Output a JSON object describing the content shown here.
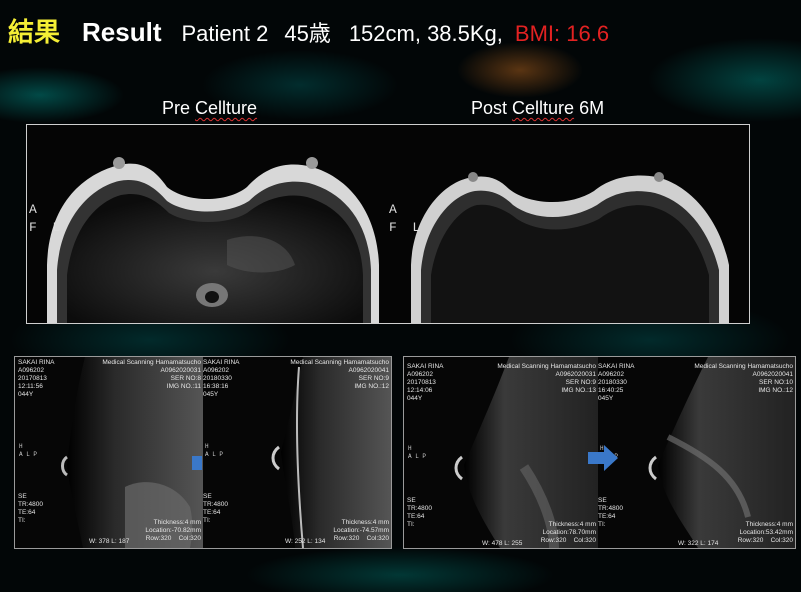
{
  "title": {
    "kanji": "結果",
    "result": "Result",
    "patient": "Patient 2",
    "age": "45歳",
    "measure": "152cm, 38.5Kg,",
    "bmi": "BMI: 16.6"
  },
  "captions": {
    "pre_prefix": "Pre ",
    "pre_word": "Cellture",
    "post_prefix": "Post ",
    "post_word": "Cellture",
    "post_suffix": " 6M"
  },
  "colors": {
    "bmi": "#e32222",
    "kanji": "#f5ef35",
    "arrow": "#3a78c9"
  },
  "orientation": {
    "a": "A",
    "f": "F",
    "l": "L"
  },
  "panels": [
    {
      "left": {
        "name": "SAKAI RINA\nA096202\n20170813\n12:11:56\n044Y",
        "site": "Medical Scanning Hamamatsucho\nA0962020031\nSER NO:8\nIMG NO.:11",
        "orient": "H\nA L P",
        "params": "SE\nTR:4800\nTE:64\nTI:",
        "thick": "Thickness:4 mm\nLocation:-70.82mm\nRow:320    Col:320",
        "wl": "W: 378 L: 187"
      },
      "right": {
        "name": "SAKAI RINA\nA096202\n20180330\n16:38:16\n045Y",
        "site": "Medical Scanning Hamamatsucho\nA0962020041\nSER NO:9\nIMG NO.:12",
        "orient": "H\nA L P",
        "params": "SE\nTR:4800\nTE:64\nTI:",
        "thick": "Thickness:4 mm\nLocation:-74.57mm\nRow:320    Col:320",
        "wl": "W: 252 L: 134"
      }
    },
    {
      "left": {
        "name": "SAKAI RINA\nA096202\n20170813\n12:14:06\n044Y",
        "site": "Medical Scanning Hamamatsucho\nA0962020031\nSER NO:9\nIMG NO.:13",
        "orient": "H\nA L P",
        "params": "SE\nTR:4800\nTE:64\nTI:",
        "thick": "Thickness:4 mm\nLocation:78.70mm\nRow:320    Col:320",
        "wl": "W: 478 L: 255"
      },
      "right": {
        "name": "SAKAI RINA\nA096202\n20180330\n16:40:25\n045Y",
        "site": "Medical Scanning Hamamatsucho\nA0962020041\nSER NO:10\nIMG NO.:12",
        "orient": "H\nA L P",
        "params": "SE\nTR:4800\nTE:64\nTI:",
        "thick": "Thickness:4 mm\nLocation:53.42mm\nRow:320    Col:320",
        "wl": "W: 322 L: 174"
      }
    }
  ]
}
